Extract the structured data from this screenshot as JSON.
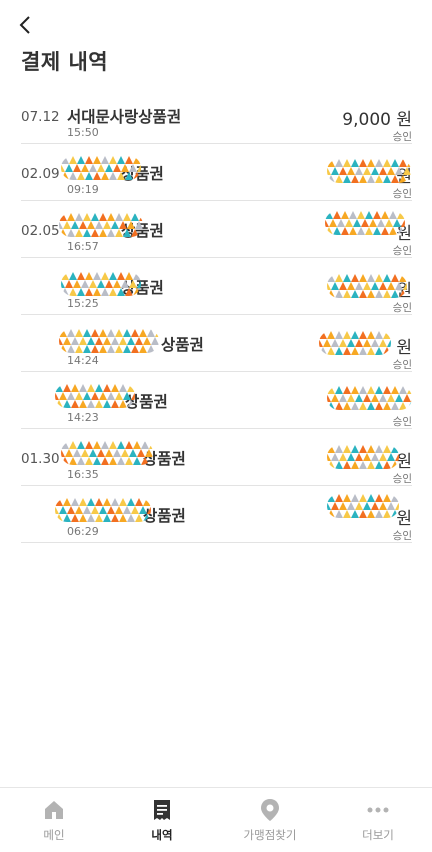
{
  "header": {
    "title": "결제 내역"
  },
  "transactions": [
    {
      "date": "07.12",
      "name": "서대문사랑상품권",
      "time": "15:50",
      "amount": "9,000 원",
      "status": "승인"
    },
    {
      "date": "02.09",
      "name": "상품권",
      "time": "09:19",
      "amount": "원",
      "status": "승인"
    },
    {
      "date": "02.05",
      "name": "상품권",
      "time": "16:57",
      "amount": "원",
      "status": "승인"
    },
    {
      "date": "",
      "name": "상품권",
      "time": "15:25",
      "amount": "원",
      "status": "승인"
    },
    {
      "date": "",
      "name": "상품권",
      "time": "14:24",
      "amount": "원",
      "status": "승인"
    },
    {
      "date": "",
      "name": "상품권",
      "time": "14:23",
      "amount": "",
      "status": "승인"
    },
    {
      "date": "01.30",
      "name": "상품권",
      "time": "16:35",
      "amount": "원",
      "status": "승인"
    },
    {
      "date": "",
      "name": "상품권",
      "time": "06:29",
      "amount": "원",
      "status": "승인"
    }
  ],
  "tabbar": {
    "items": [
      {
        "label": "메인",
        "icon": "home-icon",
        "active": false
      },
      {
        "label": "내역",
        "icon": "receipt-icon",
        "active": true
      },
      {
        "label": "가맹점찾기",
        "icon": "map-pin-icon",
        "active": false
      },
      {
        "label": "더보기",
        "icon": "more-dots-icon",
        "active": false
      }
    ]
  }
}
